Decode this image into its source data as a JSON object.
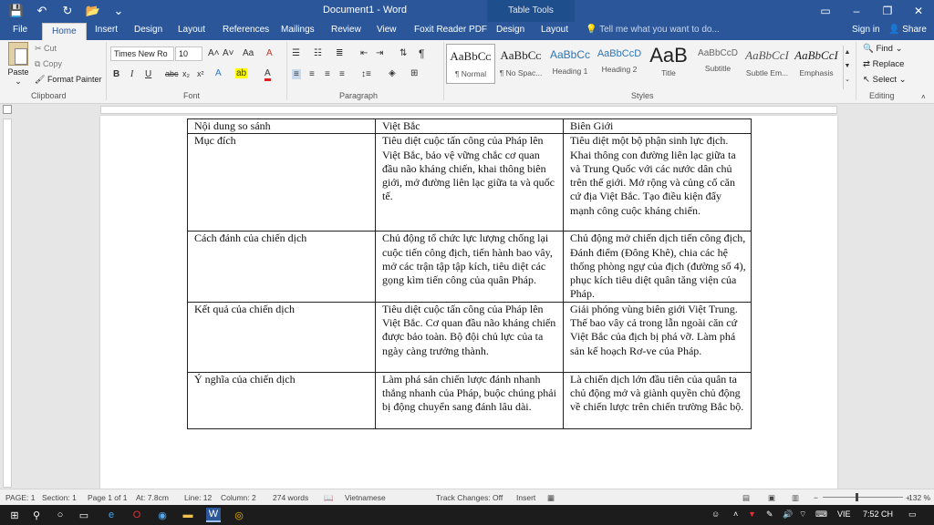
{
  "window": {
    "title": "Document1 - Word",
    "context_tab_group": "Table Tools",
    "controls": {
      "minimize": "–",
      "restore": "❐",
      "close": "✕"
    }
  },
  "qat": {
    "save_icon": "💾",
    "undo_icon": "↶",
    "redo_icon": "↻",
    "open_icon": "📂",
    "customize_icon": "⌄"
  },
  "tabs": [
    "File",
    "Home",
    "Insert",
    "Design",
    "Layout",
    "References",
    "Mailings",
    "Review",
    "View",
    "Foxit Reader PDF",
    "Design",
    "Layout"
  ],
  "tell_me": "Tell me what you want to do...",
  "account": {
    "signin": "Sign in",
    "share": "Share"
  },
  "ribbon": {
    "clipboard": {
      "label": "Clipboard",
      "paste": "Paste",
      "cut": "Cut",
      "copy": "Copy",
      "format_painter": "Format Painter"
    },
    "font": {
      "label": "Font",
      "font_name": "Times New Ro",
      "font_size": "10"
    },
    "paragraph": {
      "label": "Paragraph"
    },
    "styles": {
      "label": "Styles",
      "items": [
        {
          "preview": "AaBbCᴄ",
          "name": "¶ Normal"
        },
        {
          "preview": "AaBbCᴄ",
          "name": "¶ No Spac..."
        },
        {
          "preview": "AaBbCᴄ",
          "name": "Heading 1"
        },
        {
          "preview": "AaBbCcD",
          "name": "Heading 2"
        },
        {
          "preview": "AaB",
          "name": "Title"
        },
        {
          "preview": "AaBbCcD",
          "name": "Subtitle"
        },
        {
          "preview": "AaBbCcI",
          "name": "Subtle Em..."
        },
        {
          "preview": "AaBbCcI",
          "name": "Emphasis"
        }
      ]
    },
    "editing": {
      "label": "Editing",
      "find": "Find",
      "replace": "Replace",
      "select": "Select"
    }
  },
  "table": {
    "header": [
      "Nội dung so sánh",
      "Việt Bắc",
      "Biên Giới"
    ],
    "rows": [
      [
        "Mục đích",
        "Tiêu diệt cuộc tấn công của Pháp lên Việt Bắc, bảo vệ vững chắc cơ quan đầu não kháng chiến, khai thông biên giới, mở đường liên lạc giữa ta và quốc tế.",
        "Tiêu diệt một bộ phận sinh lực địch. Khai thông con đường liên lạc giữa ta và Trung Quốc với các nước dân chủ trên thế giới. Mở rộng và củng cố căn cứ địa Việt Bắc. Tạo điều kiện đẩy mạnh công cuộc kháng chiến."
      ],
      [
        "Cách đánh của chiến dịch",
        "Chủ động tổ chức lực lượng chống lại cuộc tiến công địch, tiến hành bao vây, mở các trận tập tập kích, tiêu diệt các gọng kìm tiến công của quân Pháp.",
        "Chủ động mở chiến dịch tiến công địch, Đánh điểm (Đông Khê), chia các hệ thống phòng ngự của địch (đường số 4), phục kích tiêu diệt quân tăng viện của Pháp."
      ],
      [
        " Kết quả của chiến dịch",
        "Tiêu diệt cuộc tấn công của Pháp lên Việt Bắc. Cơ quan đầu não kháng chiến được bảo toàn. Bộ đội chủ lực của ta ngày càng trưởng thành.",
        "Giải phóng vùng biên giới Việt Trung. Thế bao vây cả trong lẫn ngoài căn cứ Việt Bắc của địch bị phá vỡ. Làm phá sản kế hoạch Rơ-ve của Pháp."
      ],
      [
        "Ý nghĩa của chiến dịch",
        "Làm phá sản chiến lược đánh nhanh thắng nhanh của Pháp, buộc chúng phải bị động chuyển sang đánh lâu dài.",
        "Là chiến dịch lớn đầu tiên của quân ta chủ động mở và giành quyền chủ động về chiến lược trên chiến trường Bắc bộ."
      ]
    ]
  },
  "status": {
    "page": "PAGE: 1",
    "section": "Section: 1",
    "page_of": "Page 1 of 1",
    "at": "At: 7.8cm",
    "line": "Line: 12",
    "column": "Column: 2",
    "words": "274 words",
    "language": "Vietnamese",
    "track_changes": "Track Changes: Off",
    "mode": "Insert",
    "zoom": "132 %"
  },
  "taskbar": {
    "lang": "VIE",
    "time": "7:52 CH"
  }
}
